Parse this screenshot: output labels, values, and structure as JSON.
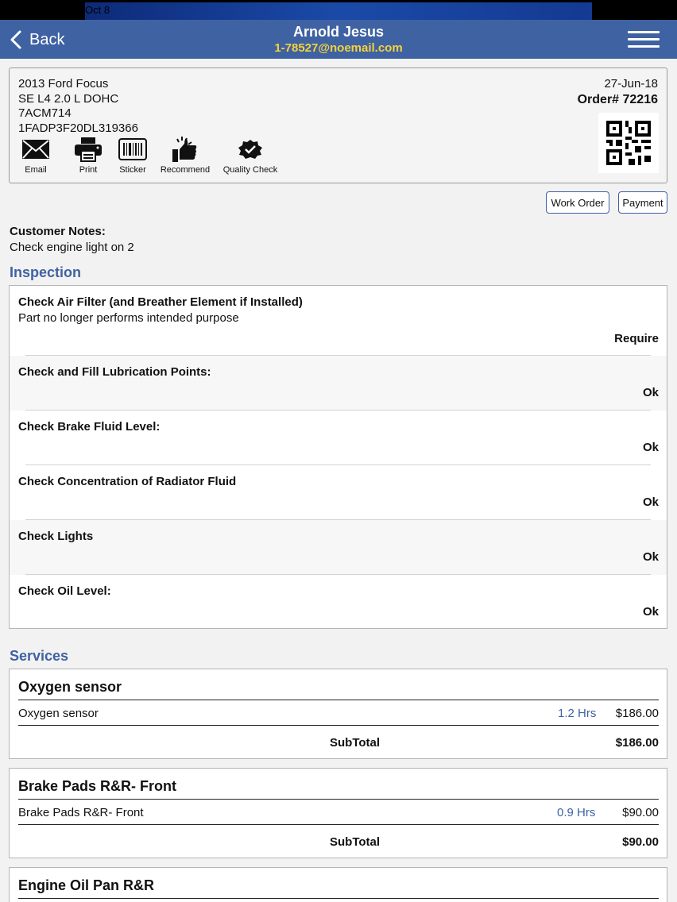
{
  "status_bar": {
    "time": "Oct 8"
  },
  "header": {
    "back_label": "Back",
    "customer_name": "Arnold Jesus",
    "customer_email": "1-78527@noemail.com"
  },
  "vehicle": {
    "model": "2013 Ford Focus",
    "trim": "SE L4 2.0 L DOHC",
    "plate": "7ACM714",
    "vin": "1FADP3F20DL319366",
    "date": "27-Jun-18",
    "order": "Order# 72216"
  },
  "actions": [
    {
      "label": "Email",
      "icon": "envelope-icon"
    },
    {
      "label": "Print",
      "icon": "printer-icon"
    },
    {
      "label": "Sticker",
      "icon": "barcode-icon"
    },
    {
      "label": "Recommend",
      "icon": "thumbs-up-icon"
    },
    {
      "label": "Quality Check",
      "icon": "quality-badge-icon"
    }
  ],
  "buttons": {
    "work_order": "Work Order",
    "payment": "Payment"
  },
  "notes": {
    "heading": "Customer Notes:",
    "text": "Check engine light on 2"
  },
  "inspection": {
    "heading": "Inspection",
    "items": [
      {
        "title": "Check Air Filter (and Breather Element if Installed)",
        "desc": "Part no longer performs intended purpose",
        "status": "Require"
      },
      {
        "title": "Check and Fill Lubrication Points:",
        "desc": "",
        "status": "Ok"
      },
      {
        "title": "Check Brake Fluid Level:",
        "desc": "",
        "status": "Ok"
      },
      {
        "title": "Check Concentration of Radiator Fluid",
        "desc": "",
        "status": "Ok"
      },
      {
        "title": "Check Lights",
        "desc": "",
        "status": "Ok"
      },
      {
        "title": "Check Oil Level:",
        "desc": "",
        "status": "Ok"
      }
    ]
  },
  "services": {
    "heading": "Services",
    "subtotal_label": "SubTotal",
    "items": [
      {
        "name": "Oxygen sensor",
        "line": "Oxygen sensor",
        "hours": "1.2 Hrs",
        "price": "$186.00",
        "subtotal": "$186.00"
      },
      {
        "name": "Brake Pads R&R- Front",
        "line": "Brake Pads R&R- Front",
        "hours": "0.9 Hrs",
        "price": "$90.00",
        "subtotal": "$90.00"
      },
      {
        "name": "Engine Oil Pan R&R",
        "line": "",
        "hours": "",
        "price": "",
        "subtotal": ""
      }
    ]
  },
  "colors": {
    "nav": "#3f62a3",
    "email": "#f5d23a",
    "accent": "#3f62a3"
  }
}
